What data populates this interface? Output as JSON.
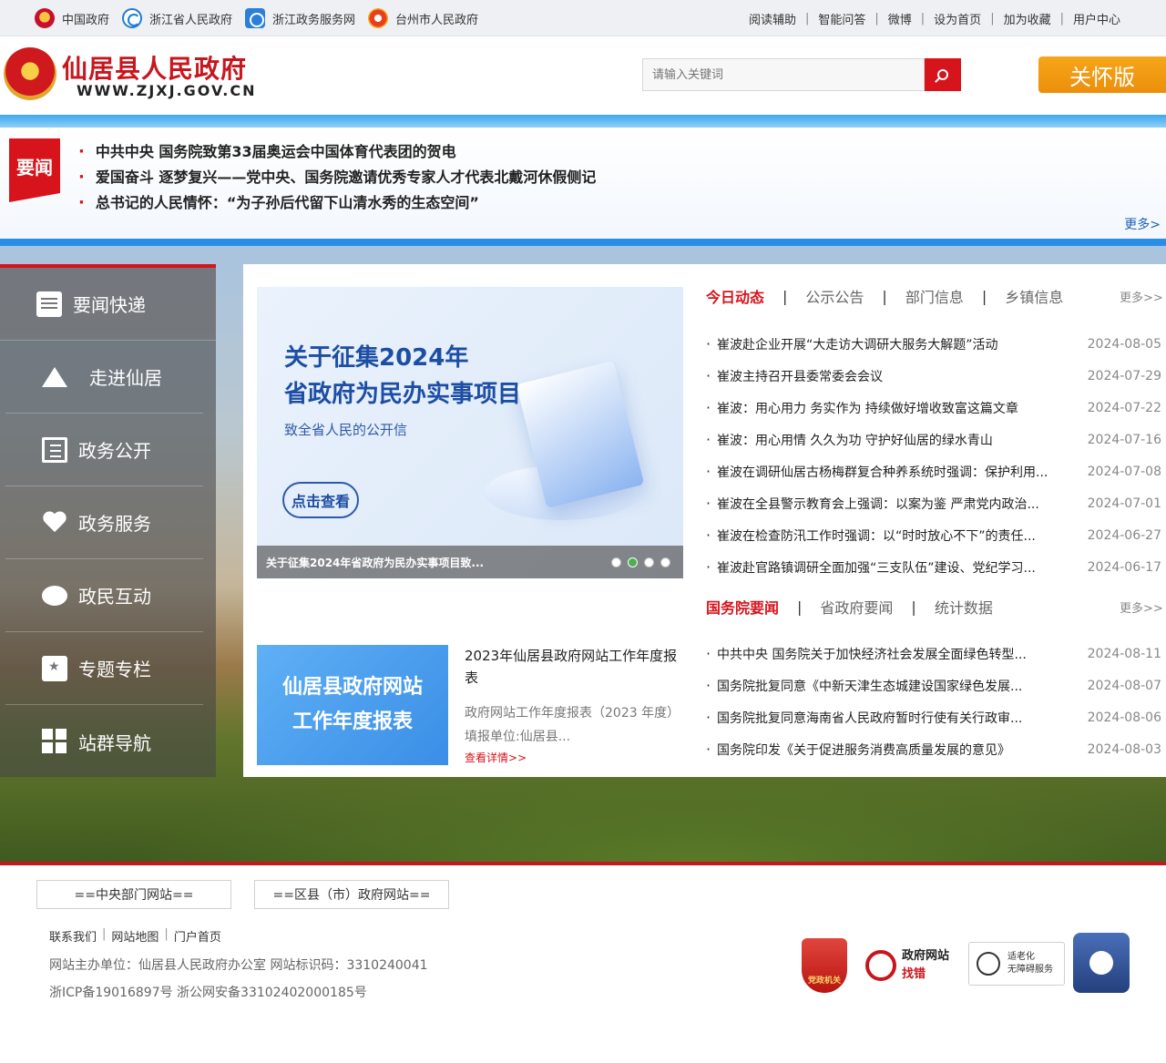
{
  "topbar": {
    "links": [
      {
        "label": "中国政府",
        "icon": "national-emblem-icon"
      },
      {
        "label": "浙江省人民政府",
        "icon": "zhejiang-gov-icon"
      },
      {
        "label": "浙江政务服务网",
        "icon": "zhejiang-service-icon"
      },
      {
        "label": "台州市人民政府",
        "icon": "taizhou-gov-icon"
      }
    ],
    "right_links": [
      "阅读辅助",
      "智能问答",
      "微博",
      "设为首页",
      "加为收藏",
      "用户中心"
    ]
  },
  "header": {
    "title": "仙居县人民政府",
    "url": "WWW.ZJXJ.GOV.CN",
    "search_placeholder": "请输入关键词",
    "care_button": "关怀版",
    "brand_color": "#c8161d"
  },
  "headlines": {
    "tag": "要闻",
    "items": [
      "中共中央 国务院致第33届奥运会中国体育代表团的贺电",
      "爱国奋斗 逐梦复兴——党中央、国务院邀请优秀专家人才代表北戴河休假侧记",
      "总书记的人民情怀：“为子孙后代留下山清水秀的生态空间”"
    ],
    "more": "更多>"
  },
  "leftnav": {
    "items": [
      {
        "label": "要闻快递",
        "icon": "newspaper-icon"
      },
      {
        "label": "走进仙居",
        "icon": "mountain-icon"
      },
      {
        "label": "政务公开",
        "icon": "document-icon"
      },
      {
        "label": "政务服务",
        "icon": "heart-icon"
      },
      {
        "label": "政民互动",
        "icon": "chat-icon"
      },
      {
        "label": "专题专栏",
        "icon": "calendar-star-icon"
      },
      {
        "label": "站群导航",
        "icon": "grid-icon"
      }
    ]
  },
  "banner": {
    "title_line1": "关于征集2024年",
    "title_line2": "省政府为民办实事项目",
    "subtitle": "致全省人民的公开信",
    "button": "点击查看",
    "caption": "关于征集2024年省政府为民办实事项目致...",
    "active_dot": 1
  },
  "report": {
    "image_line1": "仙居县政府网站",
    "image_line2": "工作年度报表",
    "title": "2023年仙居县政府网站工作年度报表",
    "desc": "政府网站工作年度报表（2023 年度） 填报单位:仙居县...",
    "more": "查看详情>>"
  },
  "dynamics": {
    "tabs": [
      "今日动态",
      "公示公告",
      "部门信息",
      "乡镇信息"
    ],
    "more": "更多>>",
    "items": [
      {
        "title": "崔波赴企业开展“大走访大调研大服务大解题”活动",
        "date": "2024-08-05"
      },
      {
        "title": "崔波主持召开县委常委会会议",
        "date": "2024-07-29"
      },
      {
        "title": "崔波：用心用力 务实作为 持续做好增收致富这篇文章",
        "date": "2024-07-22"
      },
      {
        "title": "崔波：用心用情 久久为功 守护好仙居的绿水青山",
        "date": "2024-07-16"
      },
      {
        "title": "崔波在调研仙居古杨梅群复合种养系统时强调：保护利用...",
        "date": "2024-07-08"
      },
      {
        "title": "崔波在全县警示教育会上强调：以案为鉴 严肃党内政治...",
        "date": "2024-07-01"
      },
      {
        "title": "崔波在检查防汛工作时强调：以“时时放心不下”的责任...",
        "date": "2024-06-27"
      },
      {
        "title": "崔波赴官路镇调研全面加强“三支队伍”建设、党纪学习...",
        "date": "2024-06-17"
      }
    ]
  },
  "state": {
    "tabs": [
      "国务院要闻",
      "省政府要闻",
      "统计数据"
    ],
    "more": "更多>>",
    "items": [
      {
        "title": "中共中央 国务院关于加快经济社会发展全面绿色转型...",
        "date": "2024-08-11"
      },
      {
        "title": "国务院批复同意《中新天津生态城建设国家绿色发展...",
        "date": "2024-08-07"
      },
      {
        "title": "国务院批复同意海南省人民政府暂时行使有关行政审...",
        "date": "2024-08-06"
      },
      {
        "title": "国务院印发《关于促进服务消费高质量发展的意见》",
        "date": "2024-08-03"
      }
    ]
  },
  "footer": {
    "select_central": "==中央部门网站==",
    "select_county": "==区县（市）政府网站==",
    "links": [
      "联系我们",
      "网站地图",
      "门户首页"
    ],
    "info_line1": "网站主办单位：仙居县人民政府办公室 网站标识码：3310240041",
    "info_line2": "浙ICP备19016897号 浙公网安备33102402000185号",
    "badge_party": "党政机关",
    "badge_error_line1": "政府网站",
    "badge_error_line2": "找错",
    "badge_access_line1": "适老化",
    "badge_access_line2": "无障碍服务"
  }
}
